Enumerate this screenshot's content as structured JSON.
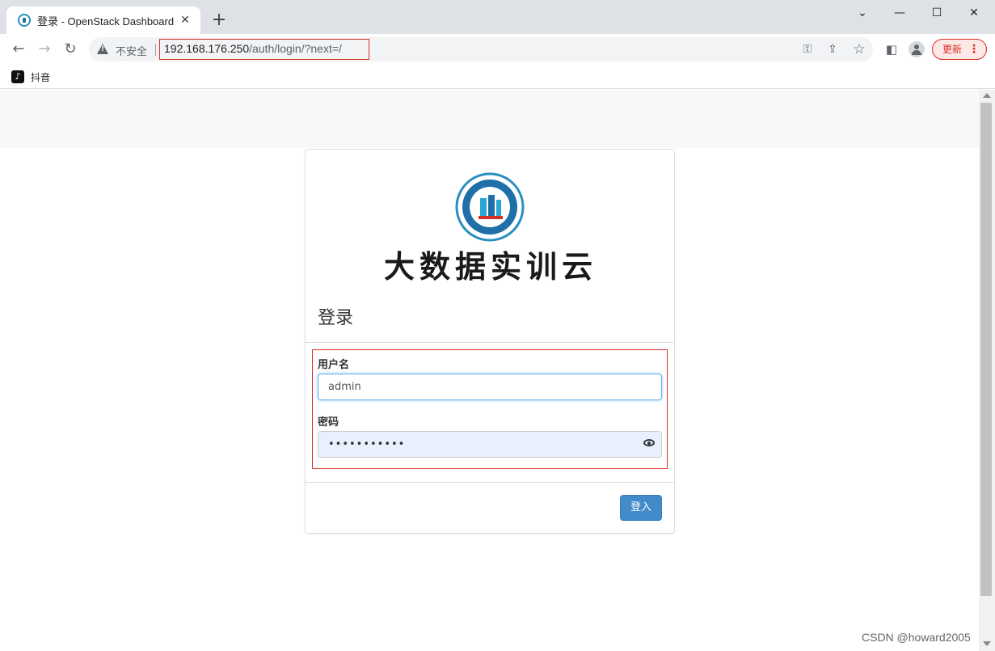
{
  "browser": {
    "tab_title": "登录 - OpenStack Dashboard",
    "tab_close": "✕",
    "new_tab": "+",
    "window_controls": {
      "minimize": "⌄",
      "restore": "—",
      "maximize": "☐",
      "close": "✕"
    },
    "nav": {
      "back": "←",
      "forward": "→",
      "reload": "↻"
    },
    "security_label": "不安全",
    "url_host": "192.168.176.250",
    "url_path": "/auth/login/?next=/",
    "omnibox_icons": {
      "key": "⚿",
      "share": "⇪",
      "star": "☆"
    },
    "sidebar_icon": "◧",
    "update_label": "更新",
    "update_menu": "⋮",
    "bookmarks": [
      {
        "label": "抖音",
        "icon": "♪"
      }
    ]
  },
  "page": {
    "logo_text": "大数据实训云",
    "login_title": "登录",
    "username_label": "用户名",
    "username_value": "admin",
    "password_label": "密码",
    "password_value": "•••••••••••",
    "submit_label": "登入"
  },
  "watermark": "CSDN @howard2005",
  "colors": {
    "accent_button": "#428bca",
    "highlight_border": "#d93025",
    "logo_ring": "#2a8fc0"
  }
}
